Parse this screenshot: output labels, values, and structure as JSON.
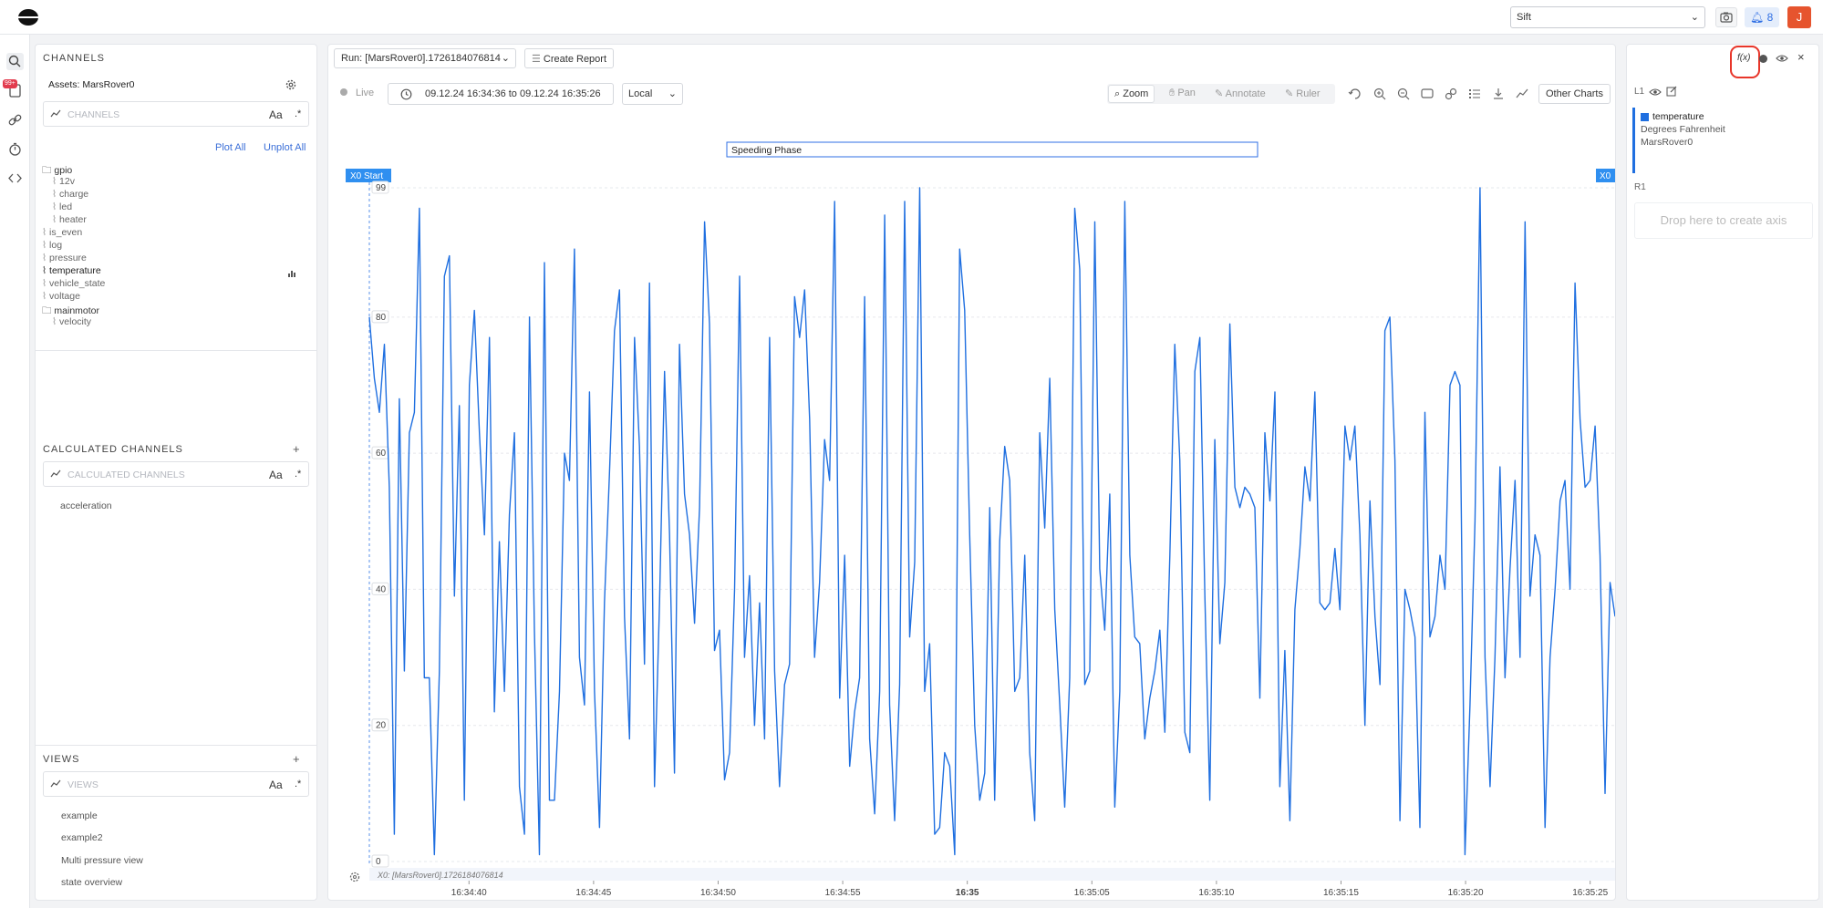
{
  "topbar": {
    "org_select": "Sift",
    "notification_count": "8",
    "user_initial": "J"
  },
  "rail": {
    "badge": "99+"
  },
  "channels": {
    "title": "CHANNELS",
    "assets_label": "Assets: MarsRover0",
    "search_placeholder": "CHANNELS",
    "case_toggle": "Aa",
    "regex_toggle": ".*",
    "plot_all": "Plot All",
    "unplot_all": "Unplot All",
    "tree": [
      {
        "label": "gpio",
        "type": "folder",
        "depth": 0
      },
      {
        "label": "12v",
        "type": "channel",
        "depth": 1
      },
      {
        "label": "charge",
        "type": "channel",
        "depth": 1
      },
      {
        "label": "led",
        "type": "channel",
        "depth": 1
      },
      {
        "label": "heater",
        "type": "channel",
        "depth": 1
      },
      {
        "label": "is_even",
        "type": "channel",
        "depth": 0
      },
      {
        "label": "log",
        "type": "channel",
        "depth": 0
      },
      {
        "label": "pressure",
        "type": "channel",
        "depth": 0
      },
      {
        "label": "temperature",
        "type": "channel",
        "depth": 0,
        "plotted": true
      },
      {
        "label": "vehicle_state",
        "type": "channel",
        "depth": 0
      },
      {
        "label": "voltage",
        "type": "channel",
        "depth": 0
      },
      {
        "label": "mainmotor",
        "type": "folder",
        "depth": 0
      },
      {
        "label": "velocity",
        "type": "channel",
        "depth": 1
      }
    ]
  },
  "calculated": {
    "title": "CALCULATED CHANNELS",
    "search_placeholder": "CALCULATED CHANNELS",
    "case_toggle": "Aa",
    "regex_toggle": ".*",
    "items": [
      "acceleration"
    ]
  },
  "views": {
    "title": "VIEWS",
    "search_placeholder": "VIEWS",
    "case_toggle": "Aa",
    "regex_toggle": ".*",
    "items": [
      "example",
      "example2",
      "Multi pressure view",
      "state overview"
    ]
  },
  "toolbar": {
    "run_select": "Run: [MarsRover0].1726184076814",
    "create_report": "Create Report",
    "live": "Live",
    "time_range": "09.12.24 16:34:36 to 09.12.24 16:35:26",
    "timezone": "Local",
    "zoom": "Zoom",
    "pan": "Pan",
    "annotate": "Annotate",
    "ruler": "Ruler",
    "other_charts": "Other Charts"
  },
  "chart": {
    "annotation_label": "Speeding Phase",
    "x0_start": "X0 Start",
    "x0_end": "X0",
    "footer_run": "X0: [MarsRover0].1726184076814"
  },
  "chart_data": {
    "type": "line",
    "title": "",
    "xlabel": "",
    "ylabel": "",
    "ylim": [
      0,
      99
    ],
    "y_ticks": [
      0,
      20,
      40,
      60,
      80,
      99
    ],
    "x_ticks": [
      "16:34:40",
      "16:34:45",
      "16:34:50",
      "16:34:55",
      "16:35",
      "16:35:05",
      "16:35:10",
      "16:35:15",
      "16:35:20",
      "16:35:25"
    ],
    "x_range_seconds": [
      0,
      50
    ],
    "series": [
      {
        "name": "temperature",
        "color": "#1f6fe0",
        "values": [
          80,
          71,
          66,
          76,
          55,
          4,
          68,
          28,
          63,
          66,
          96,
          27,
          27,
          1,
          28,
          86,
          89,
          39,
          67,
          9,
          70,
          81,
          63,
          48,
          77,
          22,
          47,
          25,
          51,
          63,
          11,
          4,
          80,
          34,
          1,
          88,
          9,
          9,
          25,
          60,
          56,
          90,
          30,
          23,
          69,
          25,
          5,
          38,
          57,
          78,
          84,
          36,
          18,
          77,
          61,
          29,
          85,
          11,
          38,
          72,
          48,
          13,
          76,
          54,
          48,
          35,
          52,
          94,
          79,
          31,
          34,
          12,
          16,
          40,
          86,
          30,
          42,
          20,
          38,
          18,
          77,
          28,
          11,
          26,
          29,
          83,
          77,
          84,
          65,
          30,
          41,
          62,
          56,
          97,
          24,
          45,
          14,
          22,
          27,
          83,
          18,
          7,
          25,
          95,
          23,
          6,
          26,
          97,
          33,
          44,
          99,
          25,
          32,
          4,
          5,
          16,
          14,
          1,
          90,
          81,
          48,
          20,
          9,
          13,
          52,
          9,
          47,
          61,
          56,
          25,
          27,
          45,
          16,
          6,
          63,
          49,
          71,
          37,
          23,
          8,
          27,
          96,
          87,
          26,
          28,
          94,
          43,
          34,
          54,
          8,
          25,
          97,
          45,
          33,
          32,
          18,
          24,
          28,
          34,
          19,
          45,
          76,
          59,
          19,
          16,
          72,
          77,
          39,
          9,
          62,
          32,
          41,
          79,
          55,
          52,
          55,
          54,
          52,
          24,
          63,
          53,
          69,
          11,
          31,
          6,
          37,
          46,
          58,
          53,
          69,
          38,
          37,
          38,
          46,
          37,
          64,
          59,
          64,
          48,
          20,
          53,
          36,
          26,
          78,
          80,
          59,
          6,
          40,
          37,
          33,
          5,
          66,
          33,
          36,
          45,
          40,
          70,
          72,
          70,
          1,
          23,
          50,
          99,
          30,
          11,
          30,
          58,
          27,
          43,
          56,
          30,
          94,
          39,
          48,
          45,
          5,
          30,
          40,
          53,
          56,
          40,
          85,
          65,
          55,
          56,
          64,
          45,
          10,
          41,
          36
        ],
        "annotation_range": [
          0,
          50
        ],
        "annotation_label": "Speeding Phase"
      }
    ]
  },
  "axis_panel": {
    "l1_label": "L1",
    "series_name": "temperature",
    "series_unit": "Degrees Fahrenheit",
    "series_asset": "MarsRover0",
    "r1_label": "R1",
    "drop_zone": "Drop here to create axis",
    "accent": "#1f6fe0",
    "highlight": "#e8362a"
  }
}
